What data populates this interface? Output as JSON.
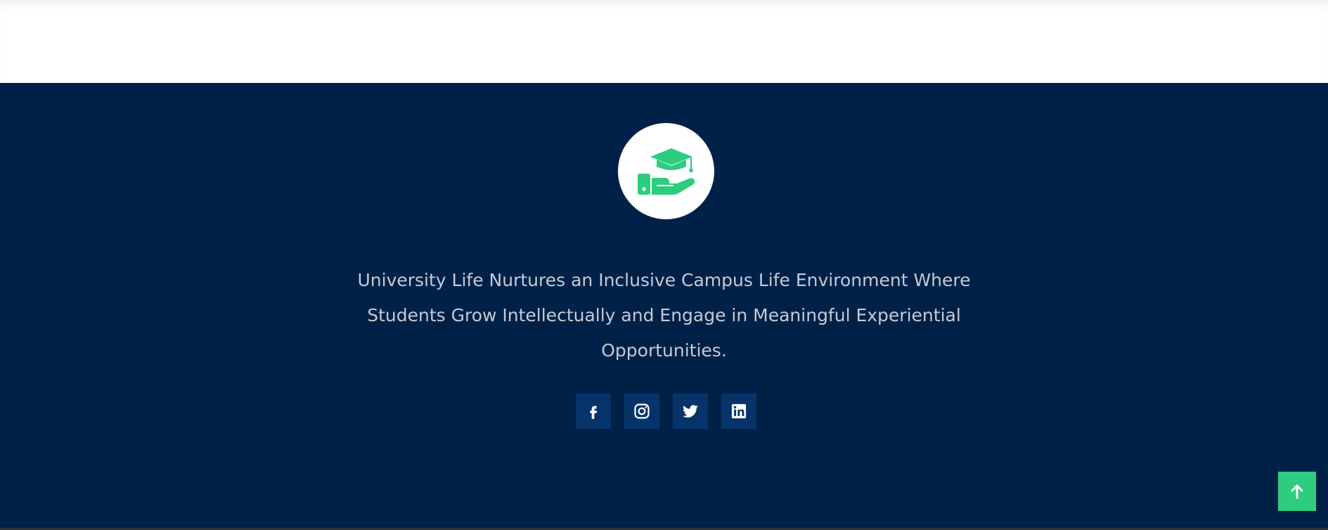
{
  "footer": {
    "tagline": "University Life Nurtures an Inclusive Campus Life Environment Where Students Grow Intellectually and Engage in Meaningful Experiential Opportunities.",
    "logo_icon": "graduation-cap-hand-icon",
    "social": [
      {
        "name": "facebook",
        "icon": "facebook-icon"
      },
      {
        "name": "instagram",
        "icon": "instagram-icon"
      },
      {
        "name": "twitter",
        "icon": "twitter-icon"
      },
      {
        "name": "linkedin",
        "icon": "linkedin-icon"
      }
    ],
    "back_to_top_icon": "arrow-up-icon"
  },
  "colors": {
    "footer_bg": "#002147",
    "accent_green": "#2ecc7f",
    "social_bg": "#07336b",
    "text_muted": "#c3cad6"
  }
}
